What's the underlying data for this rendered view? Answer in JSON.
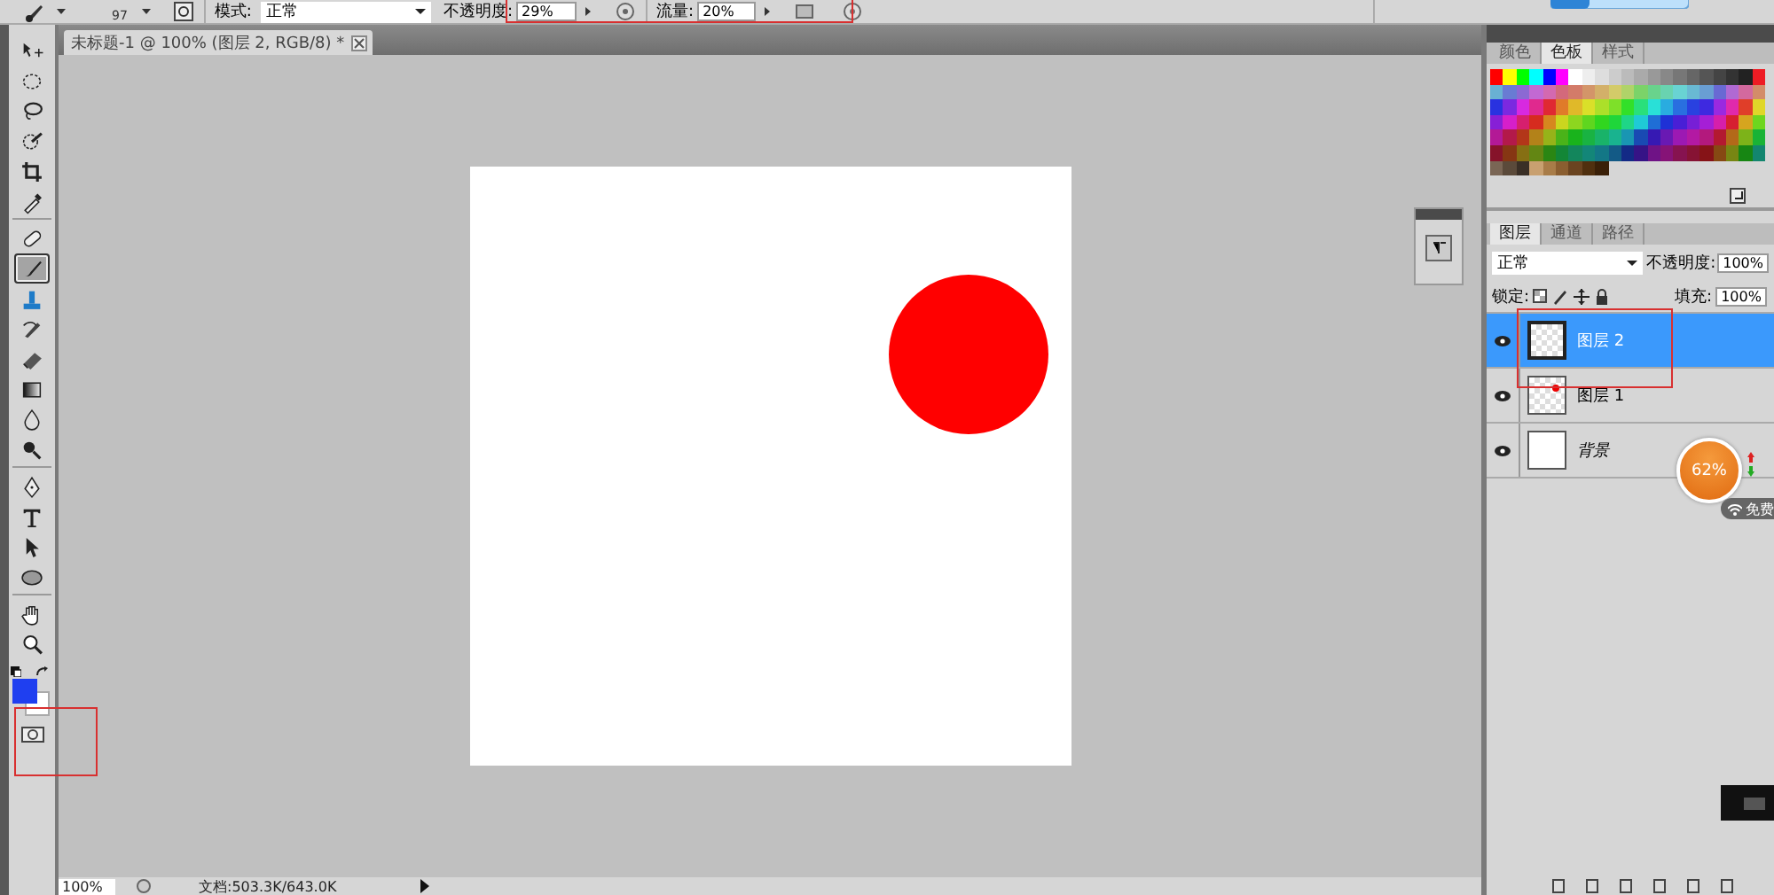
{
  "options_bar": {
    "brush_size": "97",
    "mode_label": "模式:",
    "mode_value": "正常",
    "opacity_label": "不透明度:",
    "opacity_value": "29%",
    "flow_label": "流量:",
    "flow_value": "20%"
  },
  "document": {
    "tab_title": "未标题-1 @ 100% (图层 2, RGB/8) *"
  },
  "tool_groups": [
    [
      {
        "kind": "move",
        "selected": false
      },
      {
        "kind": "marquee",
        "selected": false
      },
      {
        "kind": "lasso",
        "selected": false
      },
      {
        "kind": "quick-select",
        "selected": false
      },
      {
        "kind": "crop",
        "selected": false
      },
      {
        "kind": "eyedropper",
        "selected": false
      }
    ],
    [
      {
        "kind": "healing",
        "selected": false
      },
      {
        "kind": "brush",
        "selected": true
      },
      {
        "kind": "stamp",
        "selected": false
      },
      {
        "kind": "history",
        "selected": false
      },
      {
        "kind": "eraser",
        "selected": false
      },
      {
        "kind": "gradient",
        "selected": false
      },
      {
        "kind": "blur",
        "selected": false
      },
      {
        "kind": "dodge",
        "selected": false
      }
    ],
    [
      {
        "kind": "pen",
        "selected": false
      },
      {
        "kind": "type",
        "selected": false
      },
      {
        "kind": "path-select",
        "selected": false
      },
      {
        "kind": "ellipse",
        "selected": false
      }
    ],
    [
      {
        "kind": "hand",
        "selected": false
      },
      {
        "kind": "zoom",
        "selected": false
      }
    ]
  ],
  "swatch_panel": {
    "tabs": [
      {
        "label": "颜色",
        "selected": false
      },
      {
        "label": "色板",
        "selected": true
      },
      {
        "label": "样式",
        "selected": false
      }
    ]
  },
  "layers_panel": {
    "tabs": [
      {
        "label": "图层",
        "selected": true
      },
      {
        "label": "通道",
        "selected": false
      },
      {
        "label": "路径",
        "selected": false
      }
    ],
    "blend_mode": "正常",
    "opacity_label": "不透明度:",
    "opacity_value": "100%",
    "lock_label": "锁定:",
    "fill_label": "填充:",
    "fill_value": "100%",
    "layers": [
      {
        "name": "图层 2",
        "kind": "transparent",
        "selected": true,
        "visible": true
      },
      {
        "name": "图层 1",
        "kind": "dot",
        "selected": false,
        "visible": true
      },
      {
        "name": "背景",
        "kind": "background",
        "selected": false,
        "visible": true
      }
    ]
  },
  "network_widget": {
    "percent": "62%",
    "label": "免费"
  },
  "status_bar": {
    "zoom": "100%",
    "doc_info": "文档:503.3K/643.0K"
  }
}
